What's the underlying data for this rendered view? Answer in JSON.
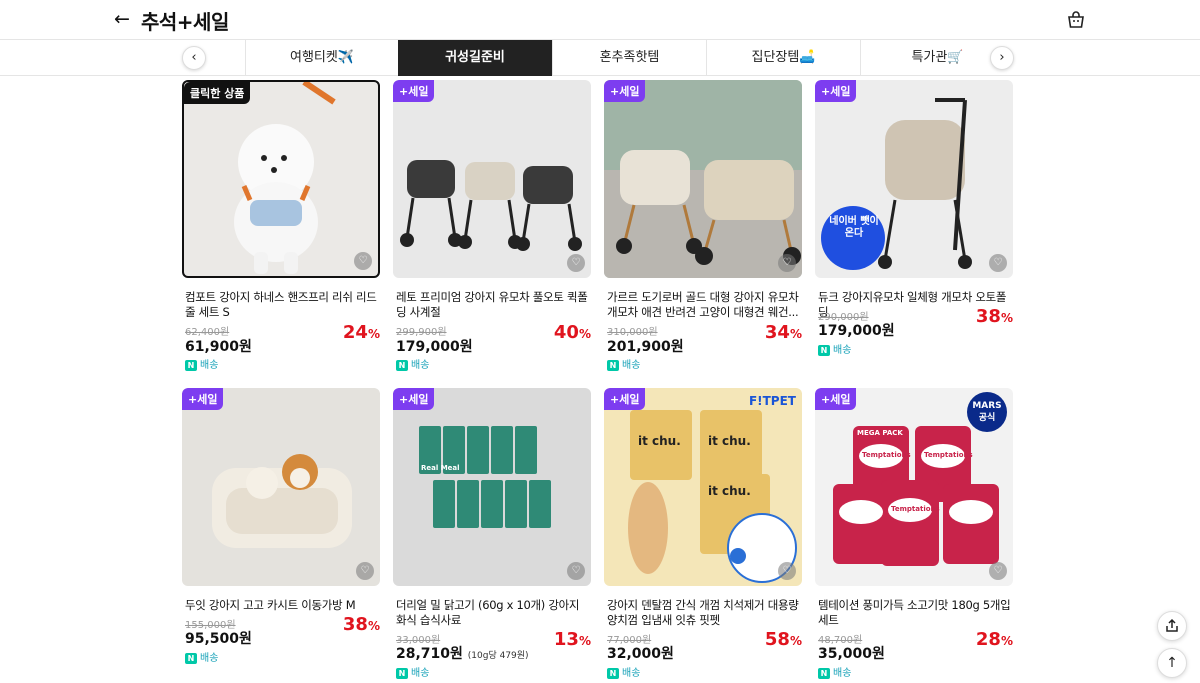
{
  "header": {
    "title": "추석+세일"
  },
  "tabs": [
    {
      "label": "여행티켓✈️"
    },
    {
      "label": "귀성길준비"
    },
    {
      "label": "혼추족핫템"
    },
    {
      "label": "집단장템🛋️"
    },
    {
      "label": "특가관🛒"
    }
  ],
  "products": [
    {
      "badge": "클릭한 상품",
      "name": "컴포트 강아지 하네스 핸즈프리 리쉬 리드줄 세트 S",
      "original_price": "62,400원",
      "price": "61,900원",
      "discount": "24",
      "shipping": "배송"
    },
    {
      "badge": "+세일",
      "name": "레토 프리미엄 강아지 유모차 풀오토 퀵폴딩 사계절",
      "original_price": "299,900원",
      "price": "179,000원",
      "discount": "40",
      "shipping": "배송"
    },
    {
      "badge": "+세일",
      "name": "가르르 도기로버 골드 대형 강아지 유모차 개모차 애견 반려견 고양이 대형견 웨건...",
      "original_price": "310,000원",
      "price": "201,900원",
      "discount": "34",
      "shipping": "배송"
    },
    {
      "badge": "+세일",
      "name": "듀크 강아지유모차 일체형 개모차 오토폴딩",
      "original_price": "290,000원",
      "price": "179,000원",
      "discount": "38",
      "shipping": "배송"
    },
    {
      "badge": "+세일",
      "name": "두잇 강아지 고고 카시트 이동가방 M",
      "original_price": "155,000원",
      "price": "95,500원",
      "discount": "38",
      "shipping": "배송"
    },
    {
      "badge": "+세일",
      "name": "더리얼 밀 닭고기 (60g x 10개) 강아지 화식 습식사료",
      "original_price": "33,000원",
      "price": "28,710원",
      "unit_price": "(10g당 479원)",
      "discount": "13",
      "shipping": "배송"
    },
    {
      "badge": "+세일",
      "name": "강아지 덴탈껌 간식 개껌 치석제거 대용량 양치껌 입냄새 잇츄 핏펫",
      "original_price": "77,000원",
      "price": "32,000원",
      "discount": "58",
      "shipping": "배송",
      "brand_mark": "F!TPET"
    },
    {
      "badge": "+세일",
      "name": "템테이션 풍미가득 소고기맛 180g 5개입세트",
      "original_price": "48,700원",
      "price": "35,000원",
      "discount": "28",
      "shipping": "배송",
      "brand_mark": "MARS 공식"
    }
  ],
  "image_text": {
    "naver_sticker": "네이버 뺏이 온다",
    "itchu": "it chu.",
    "temptations": "Temptations",
    "mega_pack": "MEGA PACK",
    "real_meal": "Real Meal"
  },
  "colors": {
    "accent": "#7d3df0",
    "discount": "#e0141e",
    "active_tab": "#222222",
    "ship": "#00c8a8"
  }
}
